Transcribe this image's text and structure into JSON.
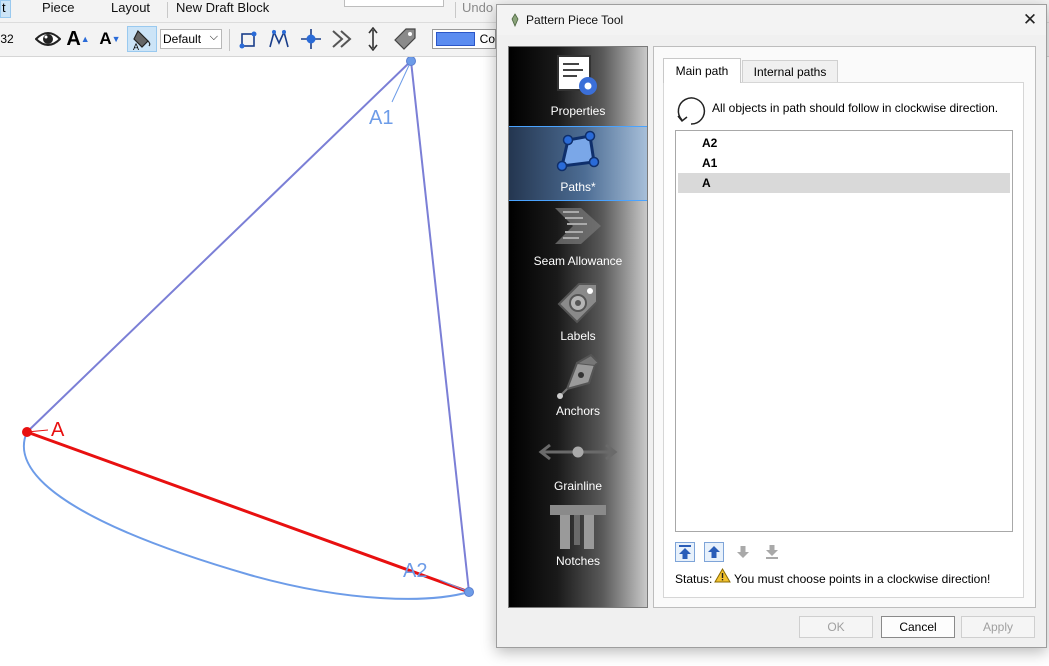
{
  "menu": {
    "edit_fragment": "t",
    "piece": "Piece",
    "layout": "Layout",
    "new_draft_block": "New Draft Block",
    "undo": "Undo"
  },
  "toolbar": {
    "size_fragment": "32",
    "font_up_glyph": "A",
    "font_down_glyph": "A",
    "line_type_value": "Default",
    "color_label_fragment": "Co",
    "color_swatch": "#5b8cf0"
  },
  "canvas": {
    "points": [
      "A1",
      "A",
      "A2"
    ],
    "colors": {
      "line": "#7b7fd6",
      "selected": "#e81010",
      "curve": "#6d9ce8"
    }
  },
  "dialog": {
    "title": "Pattern Piece Tool",
    "sidebar": [
      {
        "label": "Properties",
        "icon": "properties-icon"
      },
      {
        "label": "Paths*",
        "icon": "paths-icon",
        "active": true
      },
      {
        "label": "Seam Allowance",
        "icon": "seam-allowance-icon"
      },
      {
        "label": "Labels",
        "icon": "labels-icon"
      },
      {
        "label": "Anchors",
        "icon": "anchors-icon"
      },
      {
        "label": "Grainline",
        "icon": "grainline-icon"
      },
      {
        "label": "Notches",
        "icon": "notches-icon"
      }
    ],
    "tabs": {
      "main": "Main path",
      "internal": "Internal paths"
    },
    "direction_hint": "All objects in path should follow in clockwise direction.",
    "points_list": [
      {
        "name": "A2"
      },
      {
        "name": "A1"
      },
      {
        "name": "A",
        "selected": true
      }
    ],
    "status_label": "Status:",
    "status_message": "You must choose points in a clockwise direction!",
    "buttons": {
      "ok": "OK",
      "cancel": "Cancel",
      "apply": "Apply"
    },
    "accent": "#4aa3ff"
  }
}
